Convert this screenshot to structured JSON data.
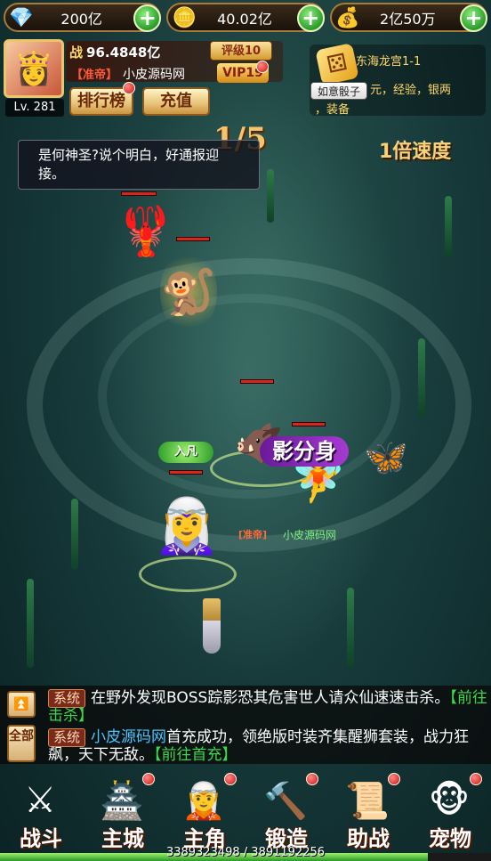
{
  "resources": [
    {
      "icon": "silver-ingot-icon",
      "glyph": "💎",
      "value": "200亿"
    },
    {
      "icon": "gold-ingot-icon",
      "glyph": "🪙",
      "value": "40.02亿"
    },
    {
      "icon": "bound-gold-icon",
      "glyph": "💰",
      "value": "2亿50万"
    }
  ],
  "player": {
    "level": "Lv. 281",
    "power_label": "战",
    "power": "96.4848亿",
    "rank": "评级10",
    "title": "【准帝】",
    "name": "小皮源码网",
    "vip": "VIP19"
  },
  "buttons": {
    "ranking": "排行榜",
    "recharge": "充值"
  },
  "stage": {
    "dice_label": "如意骰子",
    "name": "东海龙宫1-1",
    "drops_line1": "元，经验，银两",
    "drops_line2": "，装备"
  },
  "battle": {
    "wave": "1/5",
    "speed": "1倍速度",
    "speech": "是何神圣?说个明白，好通报迎接。",
    "skill": "影分身",
    "status_tag": "入凡",
    "npc_title": "[准帝]",
    "npc_name": "小皮源码网"
  },
  "chat": {
    "top_button": "⏫",
    "all_button": "全部",
    "sys_label": "系统",
    "line1_text": "在野外发现BOSS踪影恐其危害世人请众仙速速击杀。",
    "line1_link": "【前往击杀】",
    "line2_name": "小皮源码网",
    "line2_text": "首充成功，领绝版时装齐集醒狮套装，战力狂飙，天下无敌。",
    "line2_link": "【前往首充】"
  },
  "nav": [
    {
      "label": "战斗",
      "icon": "crossed-swords-icon",
      "glyph": "⚔"
    },
    {
      "label": "主城",
      "icon": "city-gate-icon",
      "glyph": "🏯"
    },
    {
      "label": "主角",
      "icon": "hero-portrait-icon",
      "glyph": "🧝"
    },
    {
      "label": "锻造",
      "icon": "forge-anvil-icon",
      "glyph": "🔨"
    },
    {
      "label": "助战",
      "icon": "assist-scroll-icon",
      "glyph": "📜"
    },
    {
      "label": "宠物",
      "icon": "pet-monkey-icon",
      "glyph": "🐵"
    }
  ],
  "exp": {
    "text": "3389323498 / 3891192256",
    "fraction": 0.871
  }
}
